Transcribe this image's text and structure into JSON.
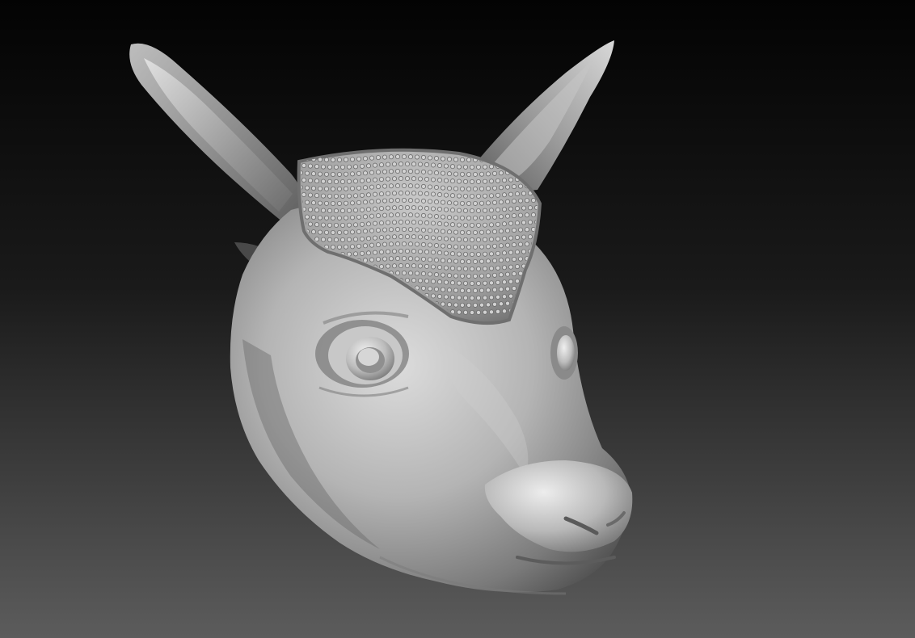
{
  "scene": {
    "subject": "sculpted-deer-head",
    "background": {
      "top_color": "#030303",
      "bottom_color": "#5c5c5c"
    },
    "material": {
      "base_color": "#9a9a9a",
      "highlight_color": "#e6e6e6",
      "shadow_color": "#3a3a3a"
    }
  }
}
